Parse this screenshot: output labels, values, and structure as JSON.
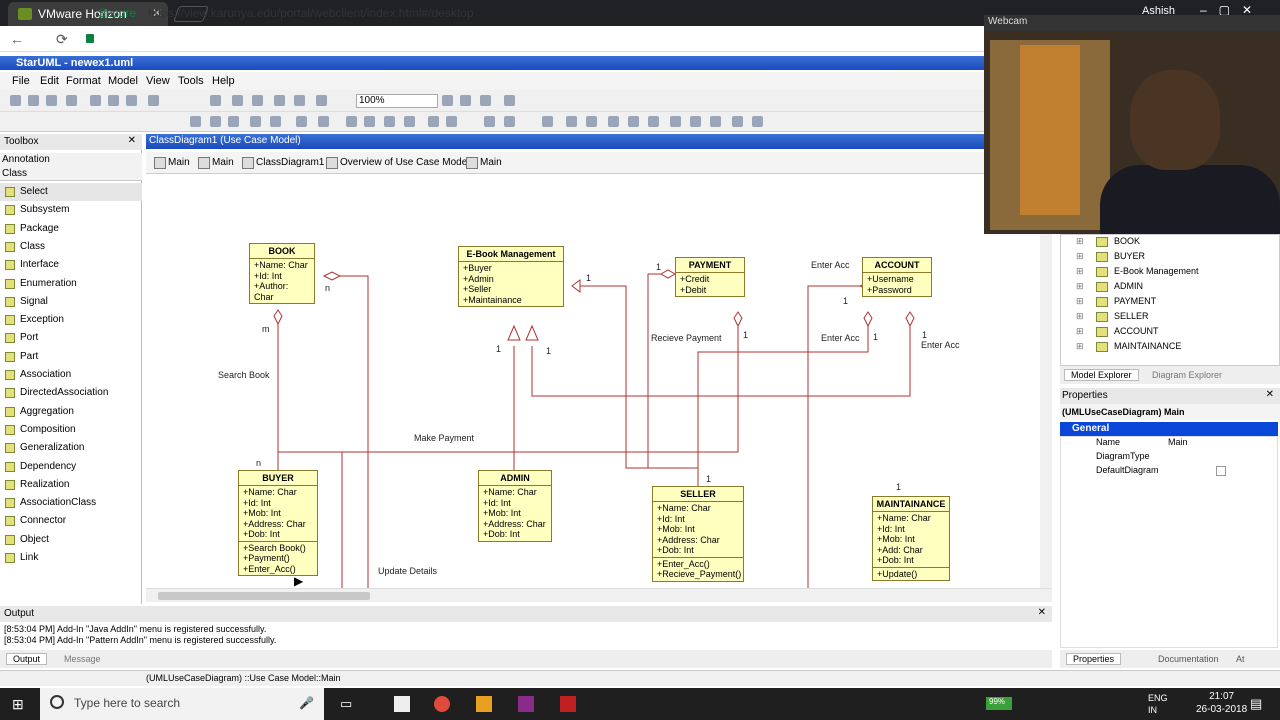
{
  "browser": {
    "tab_title": "VMware Horizon",
    "secure_label": "Secure",
    "url": "https://view.karunya.edu/portal/webclient/index.html#/desktop",
    "user": "Ashish"
  },
  "app": {
    "title": "StarUML - newex1.uml",
    "menus": [
      "File",
      "Edit",
      "Format",
      "Model",
      "View",
      "Tools",
      "Help"
    ],
    "zoom": "100%"
  },
  "toolbox": {
    "title": "Toolbox",
    "sections": [
      "Annotation",
      "Class"
    ],
    "items": [
      "Select",
      "Subsystem",
      "Package",
      "Class",
      "Interface",
      "Enumeration",
      "Signal",
      "Exception",
      "Port",
      "Part",
      "Association",
      "DirectedAssociation",
      "Aggregation",
      "Composition",
      "Generalization",
      "Dependency",
      "Realization",
      "AssociationClass",
      "Connector",
      "Object",
      "Link"
    ]
  },
  "diagram": {
    "title": "ClassDiagram1 (Use Case Model)",
    "tabs": [
      "Main",
      "Main",
      "ClassDiagram1",
      "Overview of Use Case Model",
      "Main"
    ],
    "classes": {
      "book": {
        "name": "BOOK",
        "attrs": [
          "+Name: Char",
          "+Id: Int",
          "+Author: Char"
        ]
      },
      "ebook": {
        "name": "E-Book Management",
        "attrs": [
          "+Buyer",
          "+Admin",
          "+Seller",
          "+Maintainance"
        ]
      },
      "payment": {
        "name": "PAYMENT",
        "attrs": [
          "+Credit",
          "+Debit"
        ]
      },
      "account": {
        "name": "ACCOUNT",
        "attrs": [
          "+Username",
          "+Password"
        ]
      },
      "buyer": {
        "name": "BUYER",
        "attrs": [
          "+Name: Char",
          "+Id: Int",
          "+Mob: Int",
          "+Address: Char",
          "+Dob: Int"
        ],
        "ops": [
          "+Search Book()",
          "+Payment()",
          "+Enter_Acc()"
        ]
      },
      "admin": {
        "name": "ADMIN",
        "attrs": [
          "+Name: Char",
          "+Id: Int",
          "+Mob: Int",
          "+Address: Char",
          "+Dob: Int"
        ]
      },
      "seller": {
        "name": "SELLER",
        "attrs": [
          "+Name: Char",
          "+Id: Int",
          "+Mob: Int",
          "+Address: Char",
          "+Dob: Int"
        ],
        "ops": [
          "+Enter_Acc()",
          "+Recieve_Payment()"
        ]
      },
      "maint": {
        "name": "MAINTAINANCE",
        "attrs": [
          "+Name: Char",
          "+Id: Int",
          "+Mob: Int",
          "+Add: Char",
          "+Dob: Int"
        ],
        "ops": [
          "+Update()"
        ]
      }
    },
    "labels": {
      "search_book": "Search Book",
      "make_payment": "Make Payment",
      "update_details": "Update Details",
      "recieve_payment": "Recieve Payment",
      "enter_acc1": "Enter Acc",
      "enter_acc2": "Enter Acc",
      "enter_acc3": "Enter Acc",
      "m": "m",
      "n1": "n",
      "n2": "n",
      "one": "1"
    }
  },
  "webcam": {
    "title": "Webcam"
  },
  "explorer": {
    "items": [
      "BOOK",
      "BUYER",
      "E-Book Management",
      "ADMIN",
      "PAYMENT",
      "SELLER",
      "ACCOUNT",
      "MAINTAINANCE"
    ],
    "tabs": [
      "Model Explorer",
      "Diagram Explorer"
    ]
  },
  "properties": {
    "title": "Properties",
    "selection": "(UMLUseCaseDiagram) Main",
    "section": "General",
    "rows": [
      {
        "k": "Name",
        "v": "Main"
      },
      {
        "k": "DiagramType",
        "v": ""
      },
      {
        "k": "DefaultDiagram",
        "v": ""
      }
    ],
    "tabs": [
      "Properties",
      "Documentation",
      "At"
    ]
  },
  "output": {
    "title": "Output",
    "lines": [
      "[8:53:04 PM]  Add-In \"Java AddIn\" menu is registered successfully.",
      "[8:53:04 PM]  Add-In \"Pattern AddIn\" menu is registered successfully."
    ],
    "tabs": [
      "Output",
      "Message"
    ]
  },
  "status": "(UMLUseCaseDiagram) ::Use Case Model::Main",
  "taskbar": {
    "search_placeholder": "Type here to search",
    "lang": "ENG",
    "region": "IN",
    "time": "21:07",
    "date": "26-03-2018",
    "battery": "99%"
  }
}
